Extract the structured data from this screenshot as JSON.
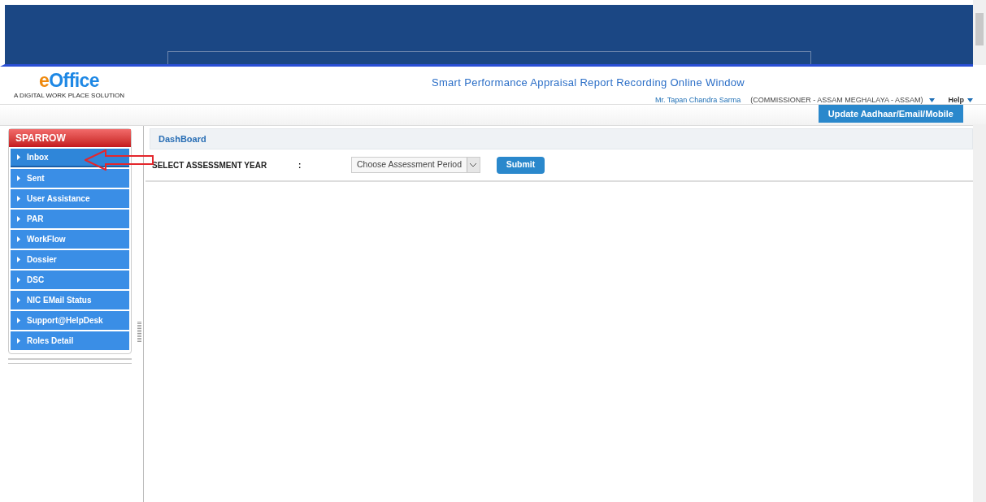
{
  "logo": {
    "name": "eOffice",
    "tagline": "A DIGITAL WORK PLACE SOLUTION"
  },
  "header": {
    "title": "Smart Performance Appraisal Report Recording Online Window",
    "user": "Mr. Tapan Chandra Sarma",
    "role": "(COMMISSIONER - ASSAM MEGHALAYA - ASSAM)",
    "help": "Help"
  },
  "update_button": "Update Aadhaar/Email/Mobile",
  "sidebar": {
    "title": "SPARROW",
    "items": [
      {
        "label": "Inbox",
        "selected": true
      },
      {
        "label": "Sent",
        "selected": false
      },
      {
        "label": "User Assistance",
        "selected": false
      },
      {
        "label": "PAR",
        "selected": false
      },
      {
        "label": "WorkFlow",
        "selected": false
      },
      {
        "label": "Dossier",
        "selected": false
      },
      {
        "label": "DSC",
        "selected": false
      },
      {
        "label": "NIC EMail Status",
        "selected": false
      },
      {
        "label": "Support@HelpDesk",
        "selected": false
      },
      {
        "label": "Roles Detail",
        "selected": false
      }
    ]
  },
  "dashboard": {
    "title": "DashBoard",
    "field_label": "SELECT ASSESSMENT YEAR",
    "colon": ":",
    "select_placeholder": "Choose Assessment Period",
    "submit": "Submit"
  }
}
